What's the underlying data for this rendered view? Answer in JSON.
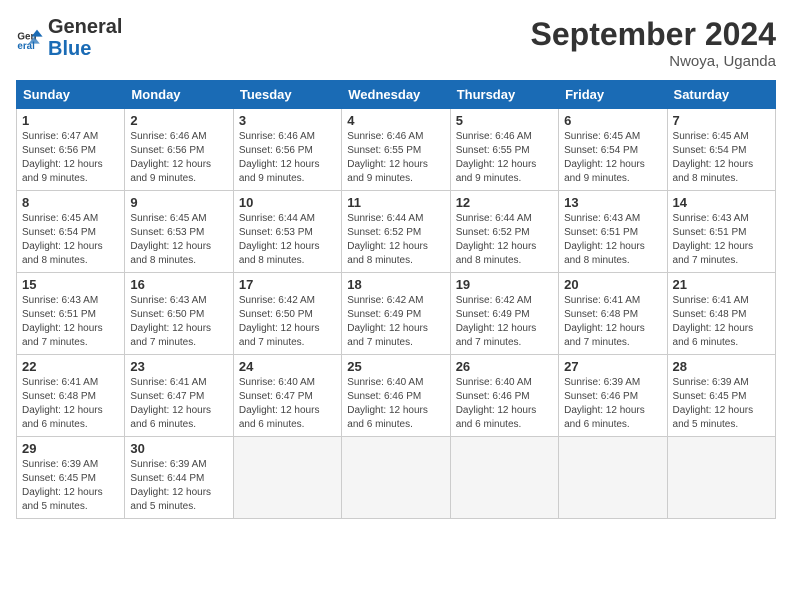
{
  "header": {
    "logo_general": "General",
    "logo_blue": "Blue",
    "month_year": "September 2024",
    "location": "Nwoya, Uganda"
  },
  "days_of_week": [
    "Sunday",
    "Monday",
    "Tuesday",
    "Wednesday",
    "Thursday",
    "Friday",
    "Saturday"
  ],
  "weeks": [
    [
      {
        "day": 1,
        "sunrise": "6:47 AM",
        "sunset": "6:56 PM",
        "daylight": "12 hours and 9 minutes."
      },
      {
        "day": 2,
        "sunrise": "6:46 AM",
        "sunset": "6:56 PM",
        "daylight": "12 hours and 9 minutes."
      },
      {
        "day": 3,
        "sunrise": "6:46 AM",
        "sunset": "6:56 PM",
        "daylight": "12 hours and 9 minutes."
      },
      {
        "day": 4,
        "sunrise": "6:46 AM",
        "sunset": "6:55 PM",
        "daylight": "12 hours and 9 minutes."
      },
      {
        "day": 5,
        "sunrise": "6:46 AM",
        "sunset": "6:55 PM",
        "daylight": "12 hours and 9 minutes."
      },
      {
        "day": 6,
        "sunrise": "6:45 AM",
        "sunset": "6:54 PM",
        "daylight": "12 hours and 9 minutes."
      },
      {
        "day": 7,
        "sunrise": "6:45 AM",
        "sunset": "6:54 PM",
        "daylight": "12 hours and 8 minutes."
      }
    ],
    [
      {
        "day": 8,
        "sunrise": "6:45 AM",
        "sunset": "6:54 PM",
        "daylight": "12 hours and 8 minutes."
      },
      {
        "day": 9,
        "sunrise": "6:45 AM",
        "sunset": "6:53 PM",
        "daylight": "12 hours and 8 minutes."
      },
      {
        "day": 10,
        "sunrise": "6:44 AM",
        "sunset": "6:53 PM",
        "daylight": "12 hours and 8 minutes."
      },
      {
        "day": 11,
        "sunrise": "6:44 AM",
        "sunset": "6:52 PM",
        "daylight": "12 hours and 8 minutes."
      },
      {
        "day": 12,
        "sunrise": "6:44 AM",
        "sunset": "6:52 PM",
        "daylight": "12 hours and 8 minutes."
      },
      {
        "day": 13,
        "sunrise": "6:43 AM",
        "sunset": "6:51 PM",
        "daylight": "12 hours and 8 minutes."
      },
      {
        "day": 14,
        "sunrise": "6:43 AM",
        "sunset": "6:51 PM",
        "daylight": "12 hours and 7 minutes."
      }
    ],
    [
      {
        "day": 15,
        "sunrise": "6:43 AM",
        "sunset": "6:51 PM",
        "daylight": "12 hours and 7 minutes."
      },
      {
        "day": 16,
        "sunrise": "6:43 AM",
        "sunset": "6:50 PM",
        "daylight": "12 hours and 7 minutes."
      },
      {
        "day": 17,
        "sunrise": "6:42 AM",
        "sunset": "6:50 PM",
        "daylight": "12 hours and 7 minutes."
      },
      {
        "day": 18,
        "sunrise": "6:42 AM",
        "sunset": "6:49 PM",
        "daylight": "12 hours and 7 minutes."
      },
      {
        "day": 19,
        "sunrise": "6:42 AM",
        "sunset": "6:49 PM",
        "daylight": "12 hours and 7 minutes."
      },
      {
        "day": 20,
        "sunrise": "6:41 AM",
        "sunset": "6:48 PM",
        "daylight": "12 hours and 7 minutes."
      },
      {
        "day": 21,
        "sunrise": "6:41 AM",
        "sunset": "6:48 PM",
        "daylight": "12 hours and 6 minutes."
      }
    ],
    [
      {
        "day": 22,
        "sunrise": "6:41 AM",
        "sunset": "6:48 PM",
        "daylight": "12 hours and 6 minutes."
      },
      {
        "day": 23,
        "sunrise": "6:41 AM",
        "sunset": "6:47 PM",
        "daylight": "12 hours and 6 minutes."
      },
      {
        "day": 24,
        "sunrise": "6:40 AM",
        "sunset": "6:47 PM",
        "daylight": "12 hours and 6 minutes."
      },
      {
        "day": 25,
        "sunrise": "6:40 AM",
        "sunset": "6:46 PM",
        "daylight": "12 hours and 6 minutes."
      },
      {
        "day": 26,
        "sunrise": "6:40 AM",
        "sunset": "6:46 PM",
        "daylight": "12 hours and 6 minutes."
      },
      {
        "day": 27,
        "sunrise": "6:39 AM",
        "sunset": "6:46 PM",
        "daylight": "12 hours and 6 minutes."
      },
      {
        "day": 28,
        "sunrise": "6:39 AM",
        "sunset": "6:45 PM",
        "daylight": "12 hours and 5 minutes."
      }
    ],
    [
      {
        "day": 29,
        "sunrise": "6:39 AM",
        "sunset": "6:45 PM",
        "daylight": "12 hours and 5 minutes."
      },
      {
        "day": 30,
        "sunrise": "6:39 AM",
        "sunset": "6:44 PM",
        "daylight": "12 hours and 5 minutes."
      },
      null,
      null,
      null,
      null,
      null
    ]
  ]
}
